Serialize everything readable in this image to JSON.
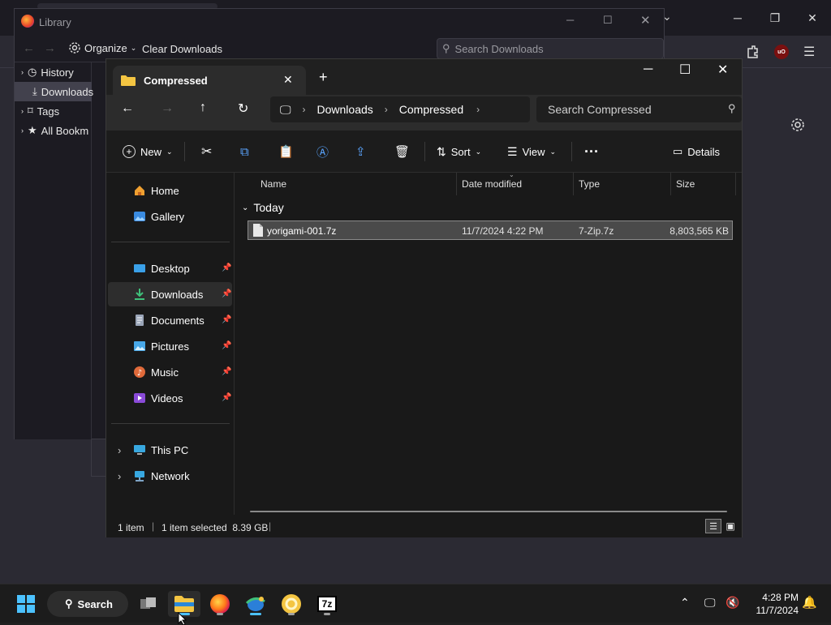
{
  "library": {
    "title": "Library",
    "organize_label": "Organize",
    "clear_downloads_label": "Clear Downloads",
    "search_placeholder": "Search Downloads",
    "items": [
      {
        "label": "History"
      },
      {
        "label": "Downloads"
      },
      {
        "label": "Tags"
      },
      {
        "label": "All Bookm"
      }
    ]
  },
  "explorer": {
    "tab_title": "Compressed",
    "breadcrumb": [
      "Downloads",
      "Compressed"
    ],
    "search_placeholder": "Search Compressed",
    "toolbar": {
      "new_label": "New",
      "sort_label": "Sort",
      "view_label": "View",
      "details_label": "Details"
    },
    "nav": {
      "quick": [
        {
          "label": "Home"
        },
        {
          "label": "Gallery"
        }
      ],
      "pinned": [
        {
          "label": "Desktop"
        },
        {
          "label": "Downloads"
        },
        {
          "label": "Documents"
        },
        {
          "label": "Pictures"
        },
        {
          "label": "Music"
        },
        {
          "label": "Videos"
        }
      ],
      "system": [
        {
          "label": "This PC"
        },
        {
          "label": "Network"
        }
      ]
    },
    "columns": [
      "Name",
      "Date modified",
      "Type",
      "Size"
    ],
    "group_label": "Today",
    "files": [
      {
        "name": "yorigami-001.7z",
        "date": "11/7/2024 4:22 PM",
        "type": "7-Zip.7z",
        "size": "8,803,565 KB"
      }
    ],
    "status": {
      "count": "1 item",
      "selection": "1 item selected  8.39 GB"
    }
  },
  "taskbar": {
    "search_label": "Search",
    "time": "4:28 PM",
    "date": "11/7/2024"
  },
  "colors": {
    "explorer_bg": "#191919",
    "selection": "#4a4a4a",
    "accent_blue": "#0078d4",
    "folder_yellow": "#f4c542"
  }
}
